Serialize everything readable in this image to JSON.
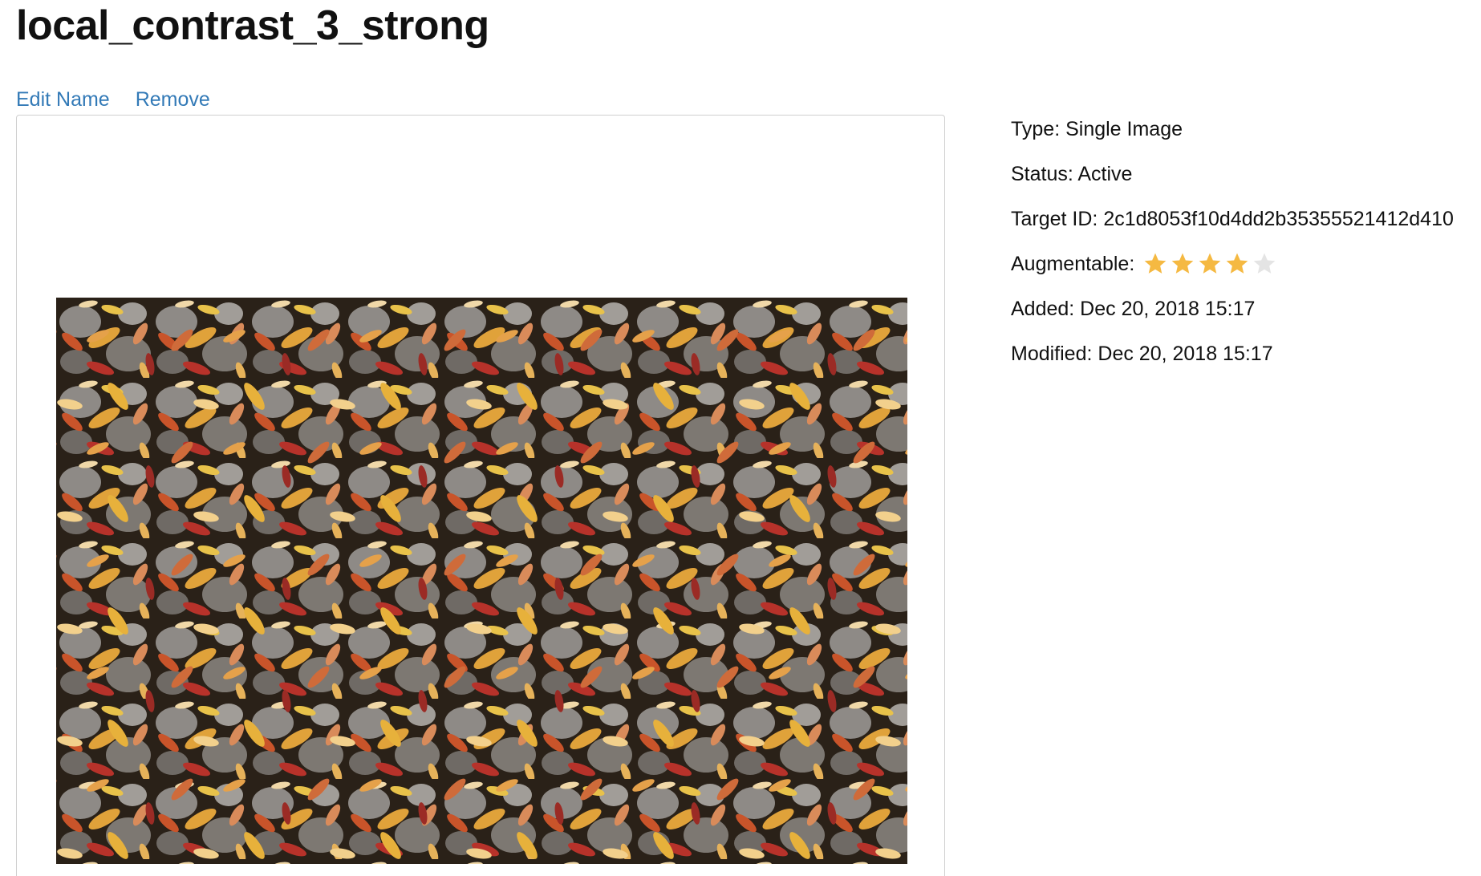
{
  "page": {
    "title": "local_contrast_3_strong"
  },
  "actions": {
    "edit_label": "Edit Name",
    "remove_label": "Remove"
  },
  "details": {
    "type": "Type: Single Image",
    "status": "Status: Active",
    "target_id": "Target ID: 2c1d8053f10d4dd2b35355521412d410",
    "augmentable_label": "Augmentable:",
    "augmentable_rating": 4,
    "augmentable_max": 5,
    "added": "Added: Dec 20, 2018 15:17",
    "modified": "Modified: Dec 20, 2018 15:17"
  },
  "colors": {
    "link": "#337ab7",
    "star_filled": "#f5b942",
    "star_empty": "#e4e4e4"
  },
  "icons": {
    "star_filled": "star-filled-icon",
    "star_empty": "star-empty-icon"
  }
}
